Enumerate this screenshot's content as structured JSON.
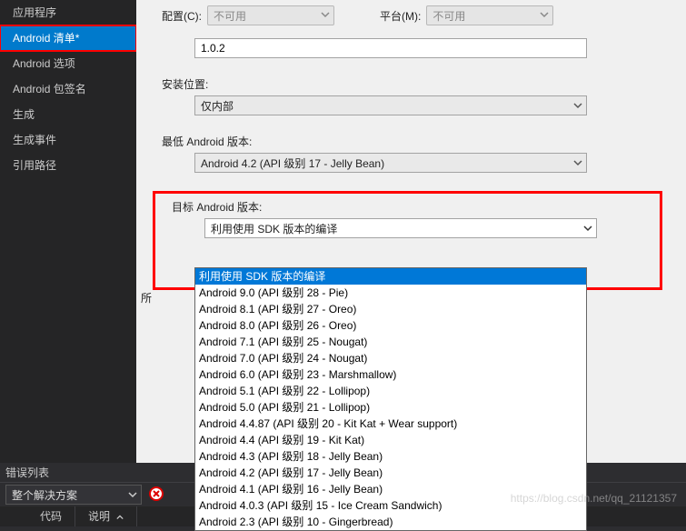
{
  "sidebar": {
    "items": [
      {
        "label": "应用程序"
      },
      {
        "label": "Android 清单*"
      },
      {
        "label": "Android 选项"
      },
      {
        "label": "Android 包签名"
      },
      {
        "label": "生成"
      },
      {
        "label": "生成事件"
      },
      {
        "label": "引用路径"
      }
    ]
  },
  "header": {
    "config_label": "配置(C):",
    "config_value": "不可用",
    "platform_label": "平台(M):",
    "platform_value": "不可用"
  },
  "fields": {
    "version_value": "1.0.2",
    "install_loc_label": "安装位置:",
    "install_loc_value": "仅内部",
    "min_android_label": "最低 Android 版本:",
    "min_android_value": "Android 4.2 (API 级别 17 - Jelly Bean)",
    "target_android_label": "目标 Android 版本:",
    "target_android_value": "利用使用 SDK 版本的编译",
    "side_label": "所"
  },
  "dropdown": {
    "options": [
      "利用使用 SDK 版本的编译",
      "Android 9.0 (API 级别 28 - Pie)",
      "Android 8.1 (API 级别 27 - Oreo)",
      "Android 8.0 (API 级别 26 - Oreo)",
      "Android 7.1 (API 级别 25 - Nougat)",
      "Android 7.0 (API 级别 24 - Nougat)",
      "Android 6.0 (API 级别 23 - Marshmallow)",
      "Android 5.1 (API 级别 22 - Lollipop)",
      "Android 5.0 (API 级别 21 - Lollipop)",
      "Android 4.4.87 (API 级别 20 - Kit Kat + Wear support)",
      "Android 4.4 (API 级别 19 - Kit Kat)",
      "Android 4.3 (API 级别 18 - Jelly Bean)",
      "Android 4.2 (API 级别 17 - Jelly Bean)",
      "Android 4.1 (API 级别 16 - Jelly Bean)",
      "Android 4.0.3 (API 级别 15 - Ice Cream Sandwich)",
      "Android 2.3 (API 级别 10 - Gingerbread)"
    ],
    "selected_index": 0
  },
  "error_list": {
    "title": "错误列表",
    "combo": "整个解决方案"
  },
  "tabs": {
    "code": "代码",
    "desc": "说明"
  },
  "watermark": "https://blog.csdn.net/qq_21121357"
}
